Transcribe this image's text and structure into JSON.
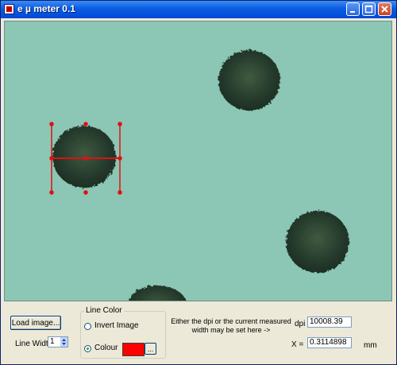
{
  "window": {
    "title": "e µ meter 0.1",
    "icon": "app-icon"
  },
  "titlebar_buttons": [
    "minimize-icon",
    "maximize-icon",
    "close-icon"
  ],
  "image_view": {
    "content": "microscope image with circular dark particles on teal background"
  },
  "controls": {
    "load_button": "Load image...",
    "line_width_label": "Line Width",
    "line_width_value": "1",
    "line_color_group": "Line Color",
    "invert_option": "Invert Image",
    "colour_option": "Colour",
    "colour_value": "#ff0000",
    "colour_browse": "...",
    "info_text_1": "Either the dpi or the current measured",
    "info_text_2": "width may be set here ->",
    "dpi_label": "dpi",
    "dpi_value": "10008.39",
    "x_label": "X =",
    "x_value": "0.3114898",
    "unit": "mm"
  }
}
